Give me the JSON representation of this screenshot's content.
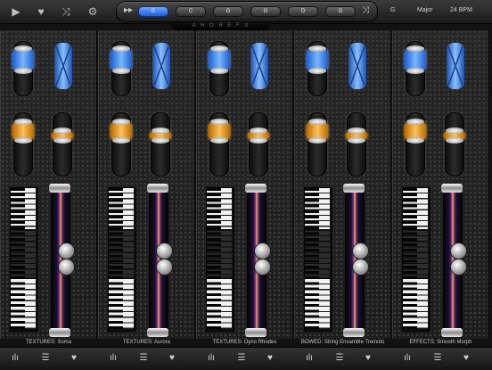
{
  "toolbar": {
    "play_icon": "play-icon",
    "favorite_icon": "heart-icon",
    "shuffle_icon": "shuffle-icon",
    "settings_icon": "gear-icon"
  },
  "chords": [
    "G",
    "C",
    "G",
    "G",
    "D",
    "G"
  ],
  "active_chord_index": 0,
  "hub_subtitle": "A H O R E F X",
  "key": "G",
  "scale": "Major",
  "tempo": "24 BPM",
  "channels": [
    {
      "label": "TEXTURES: Soma"
    },
    {
      "label": "TEXTURES: Aurora"
    },
    {
      "label": "TEXTURES: Dyno Rhodes"
    },
    {
      "label": "BOWED: String Ensamble Tremolo"
    },
    {
      "label": "EFFECTS: Smooth Morph"
    }
  ],
  "colors": {
    "accent_blue": "#4a8fff",
    "accent_orange": "#ffae3a",
    "label": "#c9c9c9"
  }
}
